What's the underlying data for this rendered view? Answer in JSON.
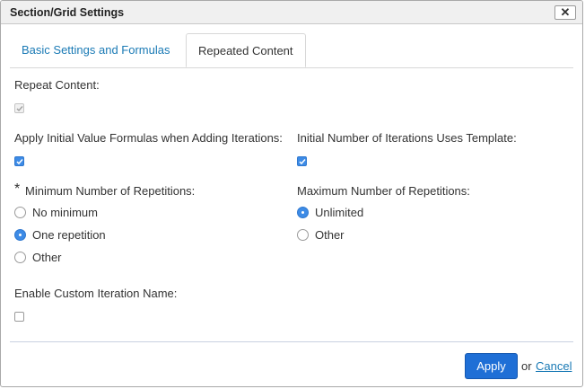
{
  "dialog": {
    "title": "Section/Grid Settings",
    "close_label": "✕"
  },
  "tabs": [
    {
      "label": "Basic Settings and Formulas",
      "active": false
    },
    {
      "label": "Repeated Content",
      "active": true
    }
  ],
  "repeat_content": {
    "label": "Repeat Content:",
    "checked": true,
    "disabled": true
  },
  "apply_initial_formulas": {
    "label": "Apply Initial Value Formulas when Adding Iterations:",
    "checked": true
  },
  "initial_iterations_template": {
    "label": "Initial Number of Iterations Uses Template:",
    "checked": true
  },
  "minimum_repetitions": {
    "required_marker": "*",
    "label": "Minimum Number of Repetitions:",
    "options": [
      {
        "label": "No minimum",
        "selected": false
      },
      {
        "label": "One repetition",
        "selected": true
      },
      {
        "label": "Other",
        "selected": false
      }
    ]
  },
  "maximum_repetitions": {
    "label": "Maximum Number of Repetitions:",
    "options": [
      {
        "label": "Unlimited",
        "selected": true
      },
      {
        "label": "Other",
        "selected": false
      }
    ]
  },
  "custom_iteration_name": {
    "label": "Enable Custom Iteration Name:",
    "checked": false
  },
  "footer": {
    "apply_label": "Apply",
    "or_label": "or",
    "cancel_label": "Cancel"
  },
  "colors": {
    "accent": "#3d8be6",
    "link": "#1a7ab5",
    "button": "#1f6fd6"
  }
}
